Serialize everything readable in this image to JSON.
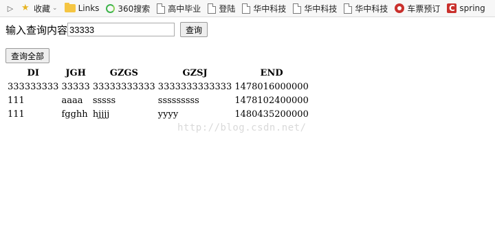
{
  "bookmarks_bar": {
    "items": [
      {
        "label": "收藏",
        "icon": "star-icon",
        "has_dropdown": true
      },
      {
        "label": "Links",
        "icon": "folder-icon"
      },
      {
        "label": "360搜索",
        "icon": "360-icon"
      },
      {
        "label": "高中毕业",
        "icon": "page-icon"
      },
      {
        "label": "登陆",
        "icon": "page-icon"
      },
      {
        "label": "华中科技",
        "icon": "page-icon"
      },
      {
        "label": "华中科技",
        "icon": "page-icon"
      },
      {
        "label": "华中科技",
        "icon": "page-icon"
      },
      {
        "label": "车票预订",
        "icon": "tomato-icon"
      },
      {
        "label": "spring",
        "icon": "c-logo-icon"
      }
    ]
  },
  "search": {
    "label": "输入查询内容",
    "value": "33333",
    "button_label": "查询"
  },
  "query_all_button": "查询全部",
  "table": {
    "headers": [
      "DI",
      "JGH",
      "GZGS",
      "GZSJ",
      "END"
    ],
    "rows": [
      [
        "333333333",
        "33333",
        "33333333333",
        "3333333333333",
        "1478016000000"
      ],
      [
        "111",
        "aaaa",
        "sssss",
        "sssssssss",
        "1478102400000"
      ],
      [
        "111",
        "fgghh",
        "hjjjj",
        "yyyy",
        "1480435200000"
      ]
    ]
  },
  "watermark": "http://blog.csdn.net/"
}
